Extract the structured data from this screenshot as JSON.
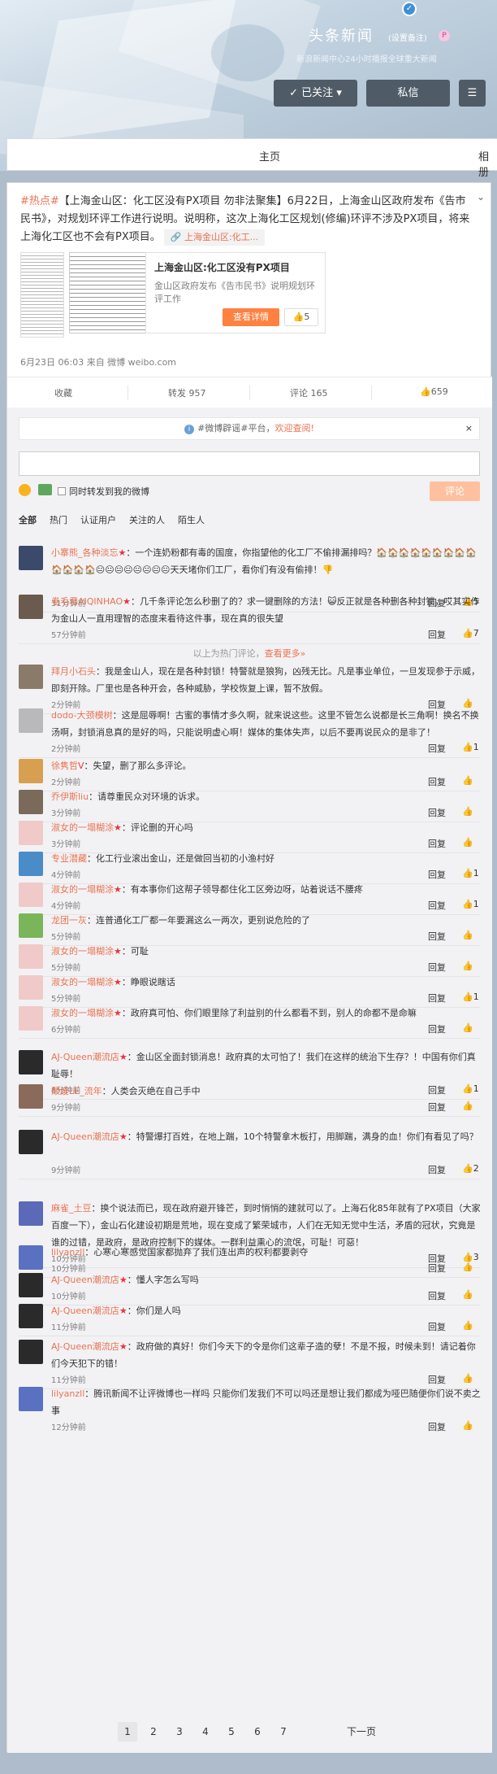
{
  "header": {
    "name": "头条新闻",
    "remark": "(设置备注)",
    "desc": "新浪新闻中心24小时播报全球重大新闻",
    "follow_label": "已关注",
    "message_label": "私信",
    "colors": {
      "brand": "#eb7350",
      "button": "#4f5b66",
      "verified": "#3f8fd9"
    }
  },
  "tabs": {
    "home": "主页",
    "album": "相册"
  },
  "post": {
    "hashtag": "#热点#",
    "text": "【上海金山区：化工区没有PX项目 勿非法聚集】6月22日，上海金山区政府发布《告市民书》，对规划环评工作进行说明。说明称，这次上海化工区规划(修编)环评不涉及PX项目，将来上海化工区也不会有PX项目。",
    "link_label": "上海金山区:化工...",
    "card_title": "上海金山区:化工区没有PX项目",
    "card_desc": "金山区政府发布《告市民书》说明规划环评工作",
    "card_button": "查看详情",
    "card_likes": "5",
    "meta": "6月23日 06:03 来自 微博 weibo.com"
  },
  "actions": {
    "favorite": "收藏",
    "repost": "转发 957",
    "comment": "评论 165",
    "like": "659"
  },
  "notice": {
    "text": "#微博辟谣#平台，",
    "link": "欢迎查阅!",
    "close": "×"
  },
  "composer": {
    "forward_label": "同时转发到我的微博",
    "submit": "评论"
  },
  "filters": [
    "全部",
    "热门",
    "认证用户",
    "关注的人",
    "陌生人"
  ],
  "labels": {
    "reply": "回复",
    "hot_sep": "以上为热门评论，",
    "more": "查看更多»"
  },
  "comments": [
    {
      "user": "小寨熊_各种淡忘",
      "badge": "★",
      "text": "：一个连奶粉都有毒的国度，你指望他的化工厂不偷排漏排吗？",
      "emoji": "🏠🏠🏠🏠🏠🏠🏠🏠🏠🏠🏠🏠🏠😐😐😐😐😐😐😐😐",
      "tail": "天天堵你们工厂，看你们有没有偷排！👎",
      "time": "31分钟前",
      "likes": "5"
    },
    {
      "user": "卷毛君AIQINHAO",
      "badge": "★",
      "text": "：几千条评论怎么秒删了的？求一键删除的方法！😺反正就是各种删各种封锁，哎其实作为金山人一直用理智的态度来看待这件事，现在真的很失望",
      "time": "57分钟前",
      "likes": "7"
    },
    {
      "user": "拜月小石头",
      "badge": "",
      "text": "：我是金山人，现在是各种封锁！特警就是狼狗，凶残无比。凡是事业单位，一旦发现参于示威，即刻开除。厂里也是各种开会，各种威胁，学校恢复上课，暂不放假。",
      "time": "2分钟前",
      "likes": ""
    },
    {
      "user": "dodo-大颈模树",
      "badge": "",
      "text": "：这是屈辱啊！古蜜的事情才多久啊，就来说这些。这里不管怎么说都是长三角啊！换名不换汤啊，封锁消息真的是好的吗，只能说明虚心啊！媒体的集体失声，以后不要再说民众的是非了！",
      "time": "2分钟前",
      "likes": "1"
    },
    {
      "user": "徐隽哲",
      "badge": "V",
      "text": "：失望，删了那么多评论。",
      "time": "2分钟前",
      "likes": ""
    },
    {
      "user": "乔伊斯liu",
      "badge": "",
      "text": "：请尊重民众对环境的诉求。",
      "time": "3分钟前",
      "likes": ""
    },
    {
      "user": "淑女的一塌糊涂",
      "badge": "★",
      "text": "：评论删的开心吗",
      "time": "3分钟前",
      "likes": ""
    },
    {
      "user": "专业潜藏",
      "badge": "",
      "text": "：化工行业滚出金山，还是做回当初的小渔村好",
      "time": "4分钟前",
      "likes": "1"
    },
    {
      "user": "淑女的一塌糊涂",
      "badge": "★",
      "text": "：有本事你们这帮子领导都住化工区旁边呀，站着说话不腰疼",
      "time": "4分钟前",
      "likes": "1"
    },
    {
      "user": "龙团一灰",
      "badge": "",
      "text": "：连普通化工厂都一年要漏这么一两次，更别说危险的了",
      "time": "5分钟前",
      "likes": ""
    },
    {
      "user": "淑女的一塌糊涂",
      "badge": "★",
      "text": "：可耻",
      "time": "5分钟前",
      "likes": ""
    },
    {
      "user": "淑女的一塌糊涂",
      "badge": "★",
      "text": "：睁眼说瞎话",
      "time": "5分钟前",
      "likes": "1"
    },
    {
      "user": "淑女的一塌糊涂",
      "badge": "★",
      "text": "：政府真可怕、你们眼里除了利益别的什么都看不到，别人的命都不是命嘛",
      "time": "6分钟前",
      "likes": ""
    },
    {
      "user": "AJ-Queen潮流店",
      "badge": "★",
      "text": "：金山区全面封锁消息！政府真的太可怕了！我们在这样的统治下生存？！中国有你们真耻辱！",
      "time": "8分钟前",
      "likes": "1"
    },
    {
      "user": "颓废LE_流年",
      "badge": "",
      "text": "：人类会灭绝在自己手中",
      "time": "9分钟前",
      "likes": ""
    },
    {
      "user": "AJ-Queen潮流店",
      "badge": "★",
      "text": "：特警爆打百姓，在地上踹，10个特警拿木板打，用脚踹，满身的血！你们有看见了吗？",
      "time": "9分钟前",
      "likes": "2"
    },
    {
      "user": "麻雀_土豆",
      "badge": "",
      "text": "：换个说法而已，现在政府避开锋芒，到时悄悄的建就可以了。上海石化85年就有了PX项目（大家百度一下），金山石化建设初期是荒地，现在变成了繁荣城市，人们在无知无觉中生活，矛盾的冠状，究竟是谁的过错，是政府，是政府控制下的媒体。一群利益熏心的流氓，可耻！可惡！",
      "time": "10分钟前",
      "likes": "3"
    },
    {
      "user": "lilyanzll",
      "badge": "",
      "text": "：心寒心寒感觉国家都抛弃了我们连出声的权利都要剥夺",
      "time": "10分钟前",
      "likes": ""
    },
    {
      "user": "AJ-Queen潮流店",
      "badge": "★",
      "text": "：懂人字怎么写吗",
      "time": "10分钟前",
      "likes": ""
    },
    {
      "user": "AJ-Queen潮流店",
      "badge": "★",
      "text": "：你们是人吗",
      "time": "11分钟前",
      "likes": ""
    },
    {
      "user": "AJ-Queen潮流店",
      "badge": "★",
      "text": "：政府做的真好！你们今天下的令是你们这辈子造的孽！不是不报，时候未到！请记着你们今天犯下的错！",
      "time": "11分钟前",
      "likes": ""
    },
    {
      "user": "lilyanzll",
      "badge": "",
      "text": "：腾讯新闻不让评微博也一样吗 只能你们发我们不可以吗还是想让我们都成为哑巴随便你们说不卖之事",
      "time": "12分钟前",
      "likes": ""
    }
  ],
  "pager": {
    "pages": [
      "1",
      "2",
      "3",
      "4",
      "5",
      "6",
      "7"
    ],
    "next": "下一页"
  }
}
